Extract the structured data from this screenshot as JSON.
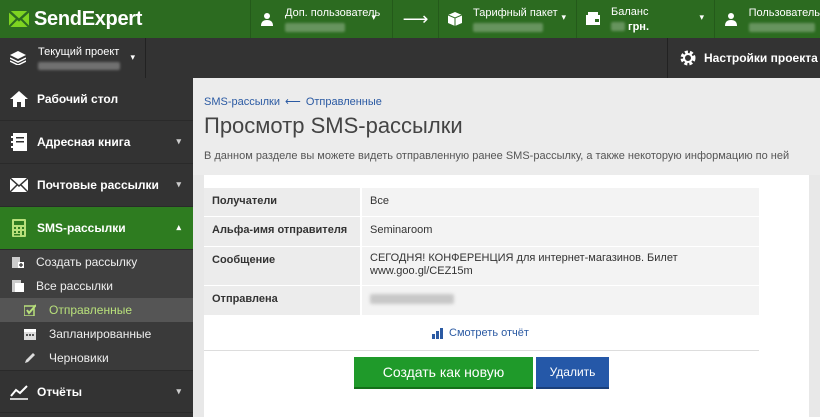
{
  "brand": {
    "name": "SendExpert"
  },
  "topbar": {
    "items": [
      {
        "label": "Доп. пользователь",
        "icon": "user-icon"
      },
      {
        "label": "Тарифный пакет",
        "icon": "box-icon"
      },
      {
        "label": "Баланс",
        "sub": "грн.",
        "icon": "wallet-icon"
      },
      {
        "label": "Пользователь",
        "icon": "user-icon"
      }
    ]
  },
  "project": {
    "label": "Текущий проект"
  },
  "settings": {
    "label": "Настройки проекта"
  },
  "sidebar": {
    "items": [
      {
        "label": "Рабочий стол"
      },
      {
        "label": "Адресная книга"
      },
      {
        "label": "Почтовые рассылки"
      },
      {
        "label": "SMS-рассылки"
      }
    ],
    "sms_sub": [
      {
        "label": "Создать рассылку"
      },
      {
        "label": "Все рассылки"
      }
    ],
    "sms_subsub": [
      {
        "label": "Отправленные"
      },
      {
        "label": "Запланированные"
      },
      {
        "label": "Черновики"
      }
    ],
    "reports": {
      "label": "Отчёты"
    }
  },
  "main": {
    "breadcrumb": {
      "parent": "SMS-рассылки",
      "current": "Отправленные",
      "arrow": "⟵"
    },
    "title": "Просмотр SMS-рассылки",
    "description": "В данном разделе вы можете видеть отправленную ранее SMS-рассылку, а также некоторую информацию по ней",
    "rows": [
      {
        "key": "Получатели",
        "value": "Все"
      },
      {
        "key": "Альфа-имя отправителя",
        "value": "Seminaroom"
      },
      {
        "key": "Сообщение",
        "value": "СЕГОДНЯ! КОНФЕРЕНЦИЯ для интернет-магазинов. Билет www.goo.gl/CEZ15m"
      },
      {
        "key": "Отправлена",
        "value": ""
      }
    ],
    "report_link": "Смотреть отчёт",
    "btn_create": "Создать как новую",
    "btn_delete": "Удалить"
  },
  "colors": {
    "topbar": "#2c6b20",
    "accent": "#1f9a2a",
    "blue": "#2558a8",
    "sidebar": "#333333"
  }
}
